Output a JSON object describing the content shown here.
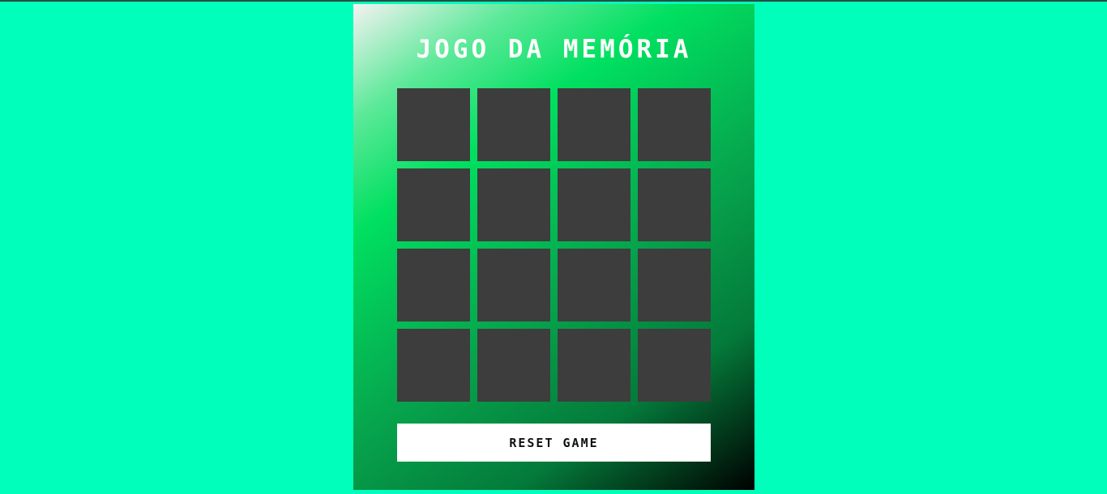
{
  "game": {
    "title": "JOGO DA MEMÓRIA",
    "rows": 4,
    "columns": 4,
    "cards": [
      {
        "state": "face-down"
      },
      {
        "state": "face-down"
      },
      {
        "state": "face-down"
      },
      {
        "state": "face-down"
      },
      {
        "state": "face-down"
      },
      {
        "state": "face-down"
      },
      {
        "state": "face-down"
      },
      {
        "state": "face-down"
      },
      {
        "state": "face-down"
      },
      {
        "state": "face-down"
      },
      {
        "state": "face-down"
      },
      {
        "state": "face-down"
      },
      {
        "state": "face-down"
      },
      {
        "state": "face-down"
      },
      {
        "state": "face-down"
      },
      {
        "state": "face-down"
      }
    ],
    "reset_label": "RESET GAME"
  },
  "colors": {
    "page_background": "#00ffbb",
    "card_back": "#3d3d3d",
    "button_background": "#ffffff",
    "title_color": "#ffffff"
  }
}
